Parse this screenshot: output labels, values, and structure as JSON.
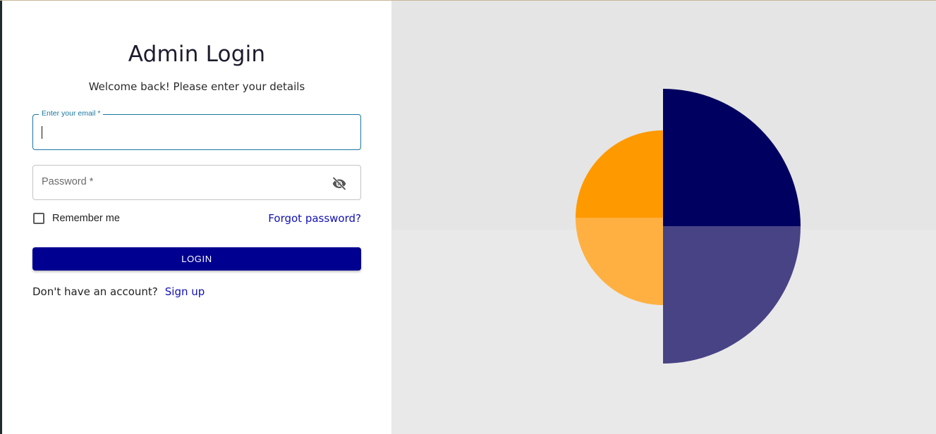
{
  "login": {
    "title": "Admin Login",
    "subtitle": "Welcome back! Please enter your details",
    "email_label": "Enter your email *",
    "email_value": "",
    "password_placeholder": "Password *",
    "password_visibility_icon": "eye-off-icon",
    "remember_label": "Remember me",
    "remember_checked": false,
    "forgot_label": "Forgot password?",
    "login_label": "LOGIN",
    "signup_prompt": "Don't have an account?",
    "signup_label": "Sign up"
  },
  "colors": {
    "primary": "#000090",
    "link": "#1010b8",
    "focus_border": "#1a76a0",
    "illustration_orange": "#ff9900",
    "illustration_orange_light": "#ffb040",
    "illustration_navy": "#000060",
    "illustration_navy_light": "#484385",
    "panel_background": "#e9e9e9"
  }
}
